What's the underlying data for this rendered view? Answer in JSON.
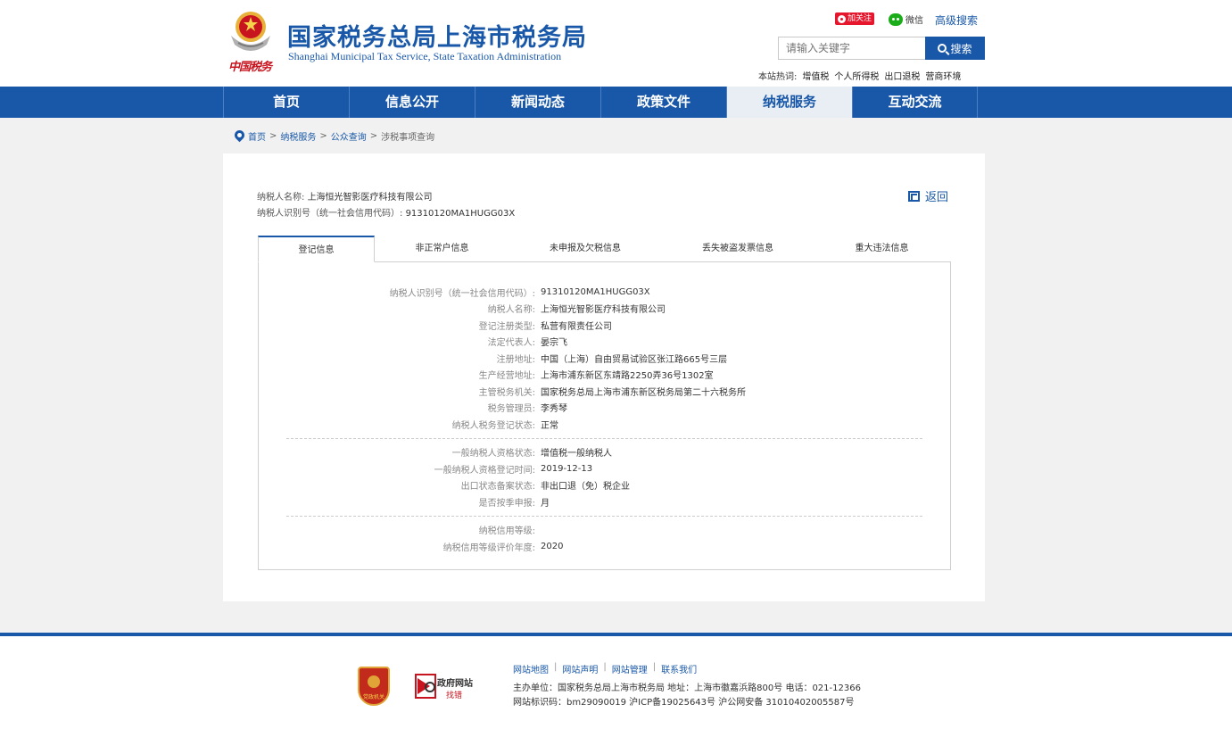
{
  "header": {
    "seal_signature": "中国税务",
    "title": "国家税务总局上海市税务局",
    "subtitle": "Shanghai Municipal Tax Service, State Taxation Administration",
    "weibo_follow": "加关注",
    "wechat": "微信",
    "advanced_search": "高级搜索",
    "search_placeholder": "请输入关键字",
    "search_button": "搜索",
    "hot_label": "本站热词:",
    "hot_words": [
      "增值税",
      "个人所得税",
      "出口退税",
      "营商环境"
    ]
  },
  "nav": [
    "首页",
    "信息公开",
    "新闻动态",
    "政策文件",
    "纳税服务",
    "互动交流"
  ],
  "breadcrumb": {
    "items": [
      "首页",
      "纳税服务",
      "公众查询",
      "涉税事项查询"
    ],
    "sep": ">"
  },
  "taxpayer": {
    "name_label": "纳税人名称:",
    "name": "上海恒光智影医疗科技有限公司",
    "id_label": "纳税人识别号（统一社会信用代码）:",
    "id": "91310120MA1HUGG03X",
    "back": "返回"
  },
  "tabs": [
    "登记信息",
    "非正常户信息",
    "未申报及欠税信息",
    "丢失被盗发票信息",
    "重大违法信息"
  ],
  "details": {
    "group1": [
      {
        "k": "纳税人识别号（统一社会信用代码）:",
        "v": "91310120MA1HUGG03X"
      },
      {
        "k": "纳税人名称:",
        "v": "上海恒光智影医疗科技有限公司"
      },
      {
        "k": "登记注册类型:",
        "v": "私营有限责任公司"
      },
      {
        "k": "法定代表人:",
        "v": "晏宗飞"
      },
      {
        "k": "注册地址:",
        "v": "中国（上海）自由贸易试验区张江路665号三层"
      },
      {
        "k": "生产经营地址:",
        "v": "上海市浦东新区东靖路2250弄36号1302室"
      },
      {
        "k": "主管税务机关:",
        "v": "国家税务总局上海市浦东新区税务局第二十六税务所"
      },
      {
        "k": "税务管理员:",
        "v": "李秀琴"
      },
      {
        "k": "纳税人税务登记状态:",
        "v": "正常"
      }
    ],
    "group2": [
      {
        "k": "一般纳税人资格状态:",
        "v": "增值税一般纳税人"
      },
      {
        "k": "一般纳税人资格登记时间:",
        "v": "2019-12-13"
      },
      {
        "k": "出口状态备案状态:",
        "v": "非出口退（免）税企业"
      },
      {
        "k": "是否按季申报:",
        "v": "月"
      }
    ],
    "group3": [
      {
        "k": "纳税信用等级:",
        "v": ""
      },
      {
        "k": "纳税信用等级评价年度:",
        "v": "2020"
      }
    ]
  },
  "footer": {
    "badge_text": "党政机关",
    "gov_site": "政府网站",
    "gov_error": "找错",
    "links": [
      "网站地图",
      "网站声明",
      "网站管理",
      "联系我们"
    ],
    "host": "主办单位：国家税务总局上海市税务局   地址：上海市徽嘉浜路800号   电话：021-12366",
    "record": "网站标识码：bm29090019  沪ICP备19025643号  沪公网安备 31010402005587号"
  },
  "colors": {
    "brand_blue": "#1958a8",
    "accent_red": "#c8141e"
  }
}
